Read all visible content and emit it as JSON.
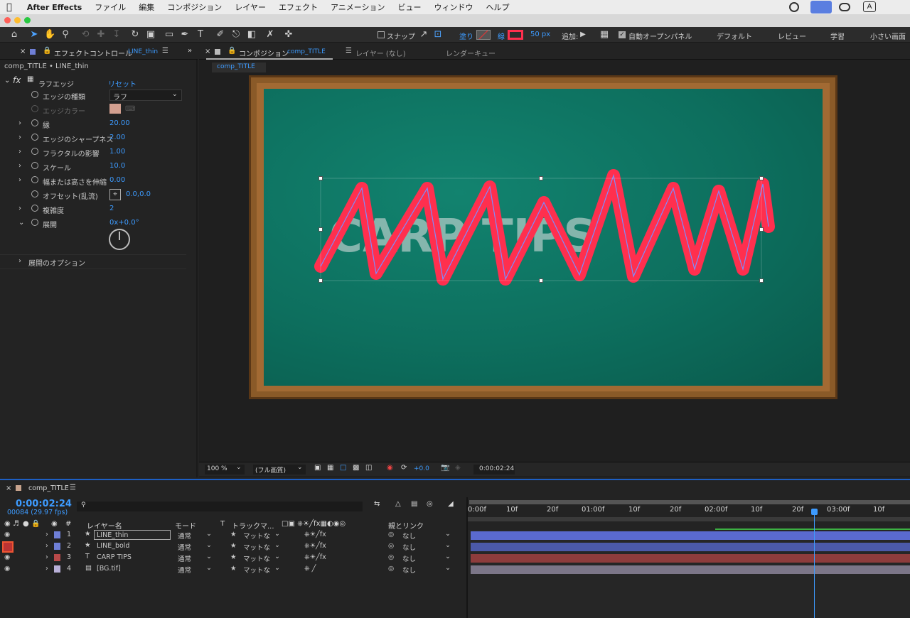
{
  "menubar": {
    "apple": "",
    "app_name": "After Effects",
    "items": [
      "ファイル",
      "編集",
      "コンポジション",
      "レイヤー",
      "エフェクト",
      "アニメーション",
      "ビュー",
      "ウィンドウ",
      "ヘルプ"
    ],
    "input_badge": "A"
  },
  "toolbar": {
    "snap_label": "スナップ",
    "fill_label": "塗り",
    "stroke_label": "線",
    "stroke_width": "50 px",
    "add_label": "追加:",
    "auto_open_label": "自動オープンパネル",
    "workspaces": [
      "デフォルト",
      "レビュー",
      "学習",
      "小さい画面"
    ]
  },
  "effect_panel": {
    "tab_label": "エフェクトコントロール",
    "tab_layer": "LINE_thin",
    "breadcrumb": "comp_TITLE • LINE_thin",
    "fx_label": "fx",
    "effect_name": "ラフエッジ",
    "reset_label": "リセット",
    "rows": [
      {
        "label": "エッジの種類",
        "value": "ラフ"
      },
      {
        "label": "エッジカラー",
        "value": ""
      },
      {
        "label": "縁",
        "value": "20.00"
      },
      {
        "label": "エッジのシャープネス",
        "value": "2.00"
      },
      {
        "label": "フラクタルの影響",
        "value": "1.00"
      },
      {
        "label": "スケール",
        "value": "10.0"
      },
      {
        "label": "幅または高さを伸縮",
        "value": "0.00"
      },
      {
        "label": "オフセット(乱流)",
        "value": "0.0,0.0"
      },
      {
        "label": "複雑度",
        "value": "2"
      },
      {
        "label": "展開",
        "value": "0x+0.0°"
      }
    ],
    "evolution_options": "展開のオプション",
    "edge_color": "#d4a090"
  },
  "comp_panel": {
    "tab_label": "コンポジション",
    "tab_comp": "comp_TITLE",
    "layer_tab": "レイヤー (なし)",
    "render_tab": "レンダーキュー",
    "sub_tab": "comp_TITLE",
    "zoom": "100 %",
    "quality": "(フル画質)",
    "exposure": "+0.0",
    "timecode": "0:00:02:24"
  },
  "timeline": {
    "tab_label": "comp_TITLE",
    "current_time": "0:00:02:24",
    "frame_info": "00084 (29.97 fps)",
    "search_placeholder": "",
    "headers": {
      "num": "#",
      "layer_name": "レイヤー名",
      "mode": "モード",
      "t": "T",
      "track_matte": "トラックマ...",
      "parent": "親とリンク"
    },
    "ruler": [
      "0:00f",
      "10f",
      "20f",
      "01:00f",
      "10f",
      "20f",
      "02:00f",
      "10f",
      "20f",
      "03:00f",
      "10f"
    ],
    "layers": [
      {
        "num": "1",
        "name": "LINE_thin",
        "icon": "star",
        "mode": "通常",
        "matte": "マットな",
        "parent": "なし",
        "color": "#6f7fd6",
        "bar": "#5a6ad0"
      },
      {
        "num": "2",
        "name": "LINE_bold",
        "icon": "star",
        "mode": "通常",
        "matte": "マットな",
        "parent": "なし",
        "color": "#6f7fd6",
        "bar": "#4b59a8"
      },
      {
        "num": "3",
        "name": "CARP TIPS",
        "icon": "T",
        "mode": "通常",
        "matte": "マットな",
        "parent": "なし",
        "color": "#b84a4a",
        "bar": "#8e3c3c"
      },
      {
        "num": "4",
        "name": "[BG.tif]",
        "icon": "file",
        "mode": "通常",
        "matte": "マットな",
        "parent": "なし",
        "color": "#b9b0d8",
        "bar": "#7c7688"
      }
    ]
  },
  "colors": {
    "accent_blue": "#3d9bff",
    "stroke_red": "#ff2f4e",
    "board_green": "#0d6f5e",
    "frame_wood": "#8a5a28"
  }
}
